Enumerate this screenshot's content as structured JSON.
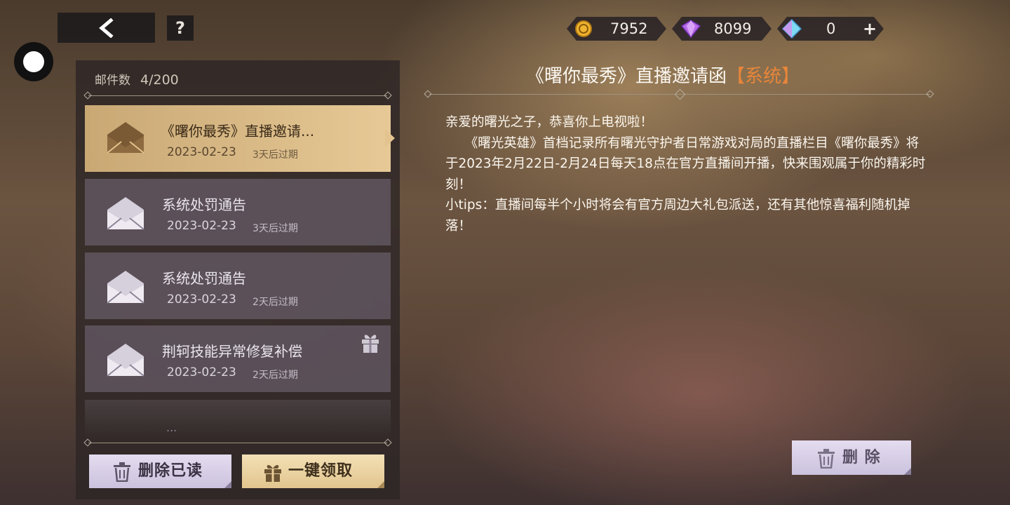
{
  "topbar": {
    "help_label": "?",
    "currencies": [
      {
        "icon": "gold-coin-icon",
        "value": "7952"
      },
      {
        "icon": "purple-gem-icon",
        "value": "8099"
      },
      {
        "icon": "blue-crystal-icon",
        "value": "0",
        "add_label": "+"
      }
    ]
  },
  "mailbox": {
    "count_label": "邮件数",
    "count_value": "4/200",
    "items": [
      {
        "title": "《曙你最秀》直播邀请...",
        "date": "2023-02-23",
        "expiry": "3天后过期",
        "selected": true
      },
      {
        "title": "系统处罚通告",
        "date": "2023-02-23",
        "expiry": "3天后过期",
        "selected": false
      },
      {
        "title": "系统处罚通告",
        "date": "2023-02-23",
        "expiry": "2天后过期",
        "selected": false
      },
      {
        "title": "荆轲技能异常修复补偿",
        "date": "2023-02-23",
        "expiry": "2天后过期",
        "selected": false,
        "has_gift": true
      }
    ],
    "ghost_dots": "...",
    "delete_read_label": "删除已读",
    "claim_all_label": "一键领取"
  },
  "detail": {
    "title": "《曙你最秀》直播邀请函",
    "tag": "【系统】",
    "paragraphs": [
      "亲爱的曙光之子，恭喜你上电视啦！",
      "　　《曙光英雄》首档记录所有曙光守护者日常游戏对局的直播栏目《曙你最秀》将于2023年2月22日-2月24日每天18点在官方直播间开播，快来围观属于你的精彩时刻！",
      "小tips：直播间每半个小时将会有官方周边大礼包派送，还有其他惊喜福利随机掉落！"
    ],
    "delete_label": "删 除"
  },
  "colors": {
    "accent_tag": "#e8863a",
    "selected_item": "#e0c18c",
    "button_lilac": "#d8d0e6",
    "button_gold": "#ecd3a2"
  }
}
